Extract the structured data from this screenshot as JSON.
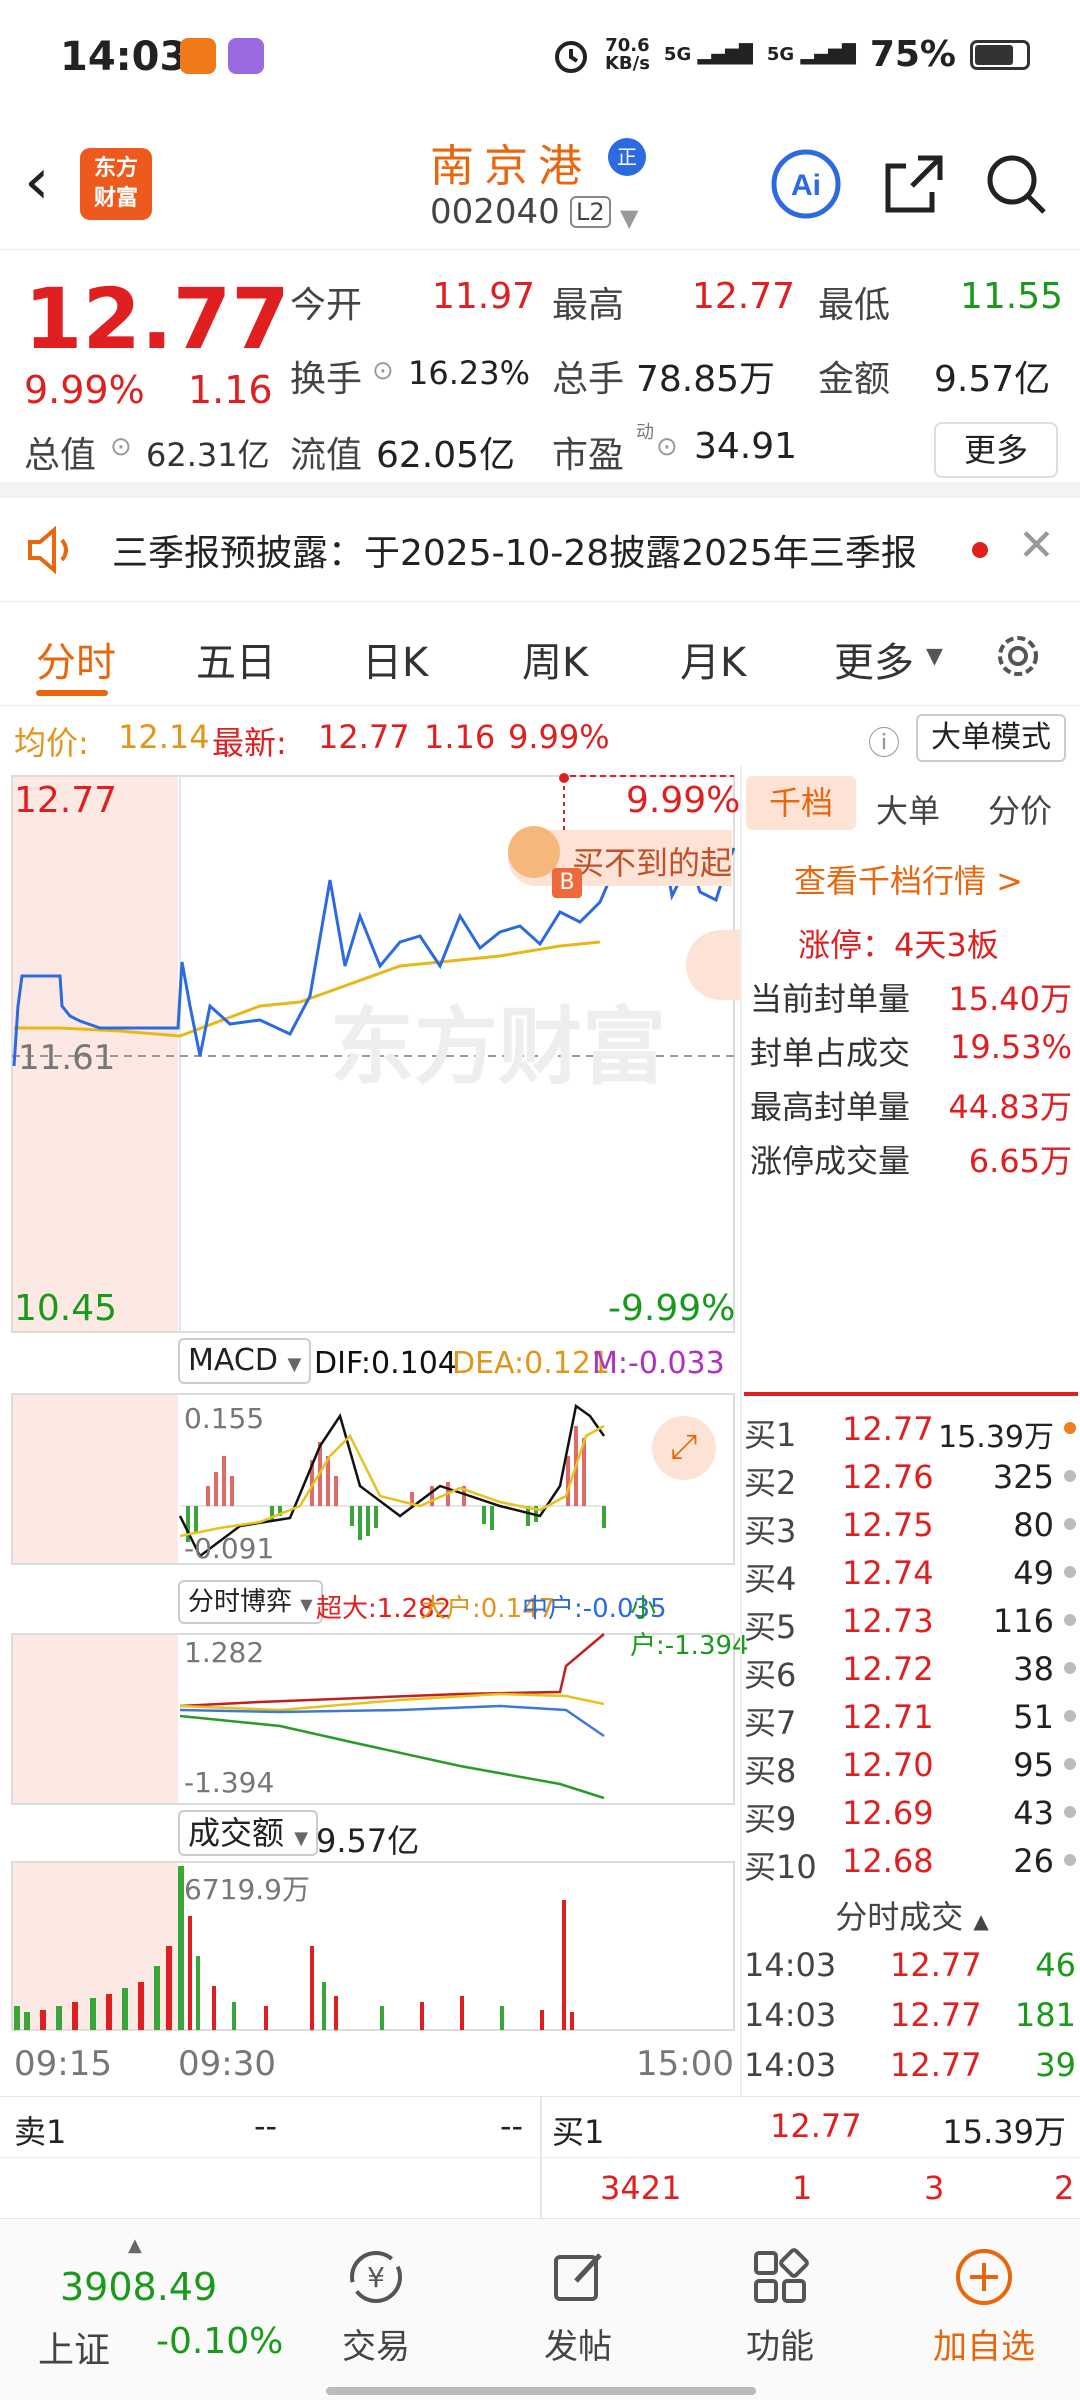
{
  "status": {
    "time": "14:03",
    "net_speed_top": "70.6",
    "net_speed_unit": "KB/s",
    "sig1": "5G",
    "sig2": "5G",
    "battery": "75%"
  },
  "header": {
    "back_icon": "chevron-left-icon",
    "logo_line1": "东方",
    "logo_line2": "财富",
    "name": "南京港",
    "name_badge": "正",
    "code": "002040",
    "level": "L2"
  },
  "quote": {
    "price": "12.77",
    "pct": "9.99%",
    "chg": "1.16",
    "open_label": "今开",
    "open": "11.97",
    "high_label": "最高",
    "high": "12.77",
    "low_label": "最低",
    "low": "11.55",
    "turnover_label": "换手",
    "turnover": "16.23%",
    "volume_label": "总手",
    "volume": "78.85万",
    "amount_label": "金额",
    "amount": "9.57亿",
    "mktcap_label": "总值",
    "mktcap": "62.31亿",
    "float_label": "流值",
    "float": "62.05亿",
    "pe_label": "市盈",
    "pe_sup": "动",
    "pe": "34.91",
    "more": "更多"
  },
  "notice": {
    "text": "三季报预披露：于2025-10-28披露2025年三季报"
  },
  "tabs": [
    "分时",
    "五日",
    "日K",
    "周K",
    "月K",
    "更多"
  ],
  "infoline": {
    "avg_label": "均价:",
    "avg": "12.14",
    "latest_label": "最新:",
    "latest": "12.77",
    "chg": "1.16",
    "pct": "9.99%",
    "mode": "大单模式"
  },
  "main_chart": {
    "top_price": "12.77",
    "mid_price": "11.61",
    "bottom_price": "10.45",
    "top_pct": "9.99%",
    "bottom_pct": "-9.99%",
    "watermark": "东方财富",
    "bubble": "买不到的起",
    "marker": "B"
  },
  "macd": {
    "label": "MACD",
    "dif": "DIF:0.104",
    "dea": "DEA:0.121",
    "m": "M:-0.033",
    "top": "0.155",
    "bottom": "-0.091"
  },
  "game": {
    "label": "分时博弈",
    "super": "超大:1.282",
    "large": "大户:0.147",
    "mid": "中户:-0.035",
    "small": "小户:-1.394",
    "top": "1.282",
    "bottom": "-1.394"
  },
  "volume": {
    "label": "成交额",
    "total": "9.57亿",
    "max": "6719.9万"
  },
  "time_axis": {
    "t1": "09:15",
    "t2": "09:30",
    "t3": "15:00"
  },
  "right_panel": {
    "tabs": [
      "千档",
      "大单",
      "分价"
    ],
    "view_link": "查看千档行情 >",
    "limit_status": "涨停：4天3板",
    "rows": [
      {
        "label": "当前封单量",
        "value": "15.40万"
      },
      {
        "label": "封单占成交",
        "value": "19.53%"
      },
      {
        "label": "最高封单量",
        "value": "44.83万"
      },
      {
        "label": "涨停成交量",
        "value": "6.65万"
      }
    ],
    "bids": [
      {
        "label": "买1",
        "price": "12.77",
        "vol": "15.39万"
      },
      {
        "label": "买2",
        "price": "12.76",
        "vol": "325"
      },
      {
        "label": "买3",
        "price": "12.75",
        "vol": "80"
      },
      {
        "label": "买4",
        "price": "12.74",
        "vol": "49"
      },
      {
        "label": "买5",
        "price": "12.73",
        "vol": "116"
      },
      {
        "label": "买6",
        "price": "12.72",
        "vol": "38"
      },
      {
        "label": "买7",
        "price": "12.71",
        "vol": "51"
      },
      {
        "label": "买8",
        "price": "12.70",
        "vol": "95"
      },
      {
        "label": "买9",
        "price": "12.69",
        "vol": "43"
      },
      {
        "label": "买10",
        "price": "12.68",
        "vol": "26"
      }
    ],
    "trades_title": "分时成交",
    "trades": [
      {
        "time": "14:03",
        "price": "12.77",
        "vol": "46"
      },
      {
        "time": "14:03",
        "price": "12.77",
        "vol": "181"
      },
      {
        "time": "14:03",
        "price": "12.77",
        "vol": "39"
      }
    ]
  },
  "orderbar": {
    "sell1": "卖1",
    "sell1_price": "--",
    "sell1_vol": "--",
    "buy1": "买1",
    "buy1_price": "12.77",
    "buy1_vol": "15.39万",
    "q1": "3421",
    "q2": "1",
    "q3": "3",
    "q4": "2"
  },
  "bottom": {
    "index_value": "3908.49",
    "index_name": "上证",
    "index_pct": "-0.10%",
    "trade": "交易",
    "post": "发帖",
    "func": "功能",
    "add": "加自选"
  }
}
